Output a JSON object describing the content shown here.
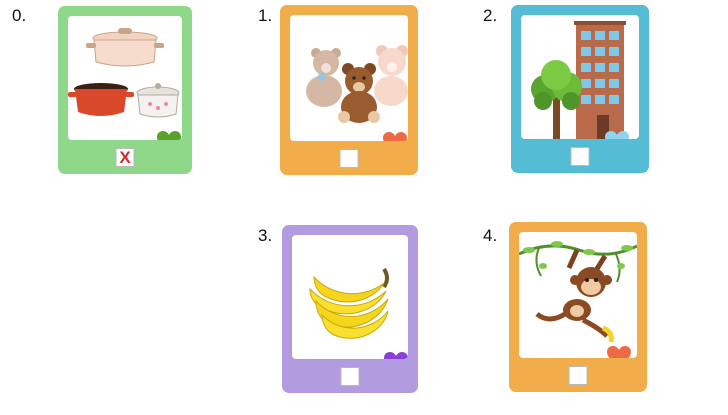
{
  "items": [
    {
      "number": "0.",
      "picture": "cooking-pots",
      "frame_color": "#8fd889",
      "heart_color": "#5aa02c",
      "answer_mark": "X"
    },
    {
      "number": "1.",
      "picture": "teddy-bears",
      "frame_color": "#f0ad4a",
      "heart_color": "#ee6a44",
      "answer_mark": ""
    },
    {
      "number": "2.",
      "picture": "building-and-tree",
      "frame_color": "#55bcd6",
      "heart_color": "#8fd3ef",
      "answer_mark": ""
    },
    {
      "number": "3.",
      "picture": "bananas",
      "frame_color": "#b39be0",
      "heart_color": "#8b3fd6",
      "answer_mark": ""
    },
    {
      "number": "4.",
      "picture": "monkey-on-vines",
      "frame_color": "#f0ad4a",
      "heart_color": "#ee6a44",
      "answer_mark": ""
    }
  ]
}
